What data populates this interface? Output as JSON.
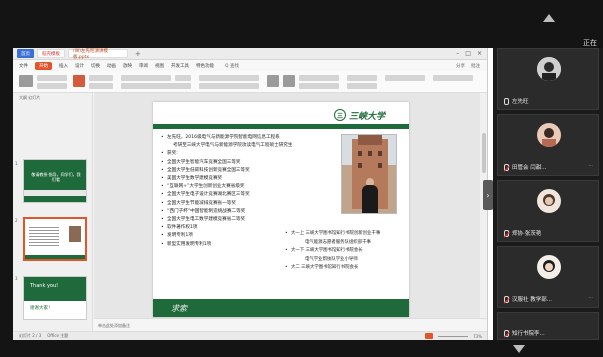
{
  "meeting": {
    "corner_label": "正在",
    "participants": [
      {
        "name": "左先旺",
        "mic": "on"
      },
      {
        "name": "田管会 闫甜...",
        "mic": "off"
      },
      {
        "name": "郑协·张茨艳",
        "mic": "off"
      },
      {
        "name": "汉服社 教学部...",
        "mic": "off"
      },
      {
        "name": "知行书院李...",
        "mic": "off"
      }
    ]
  },
  "wps": {
    "tabs": {
      "home": "首页",
      "shell": "稻壳模板",
      "doc": "(ⅡⅡ)左先旺演讲模板.pptx",
      "add": "+"
    },
    "menu": {
      "file": "文件",
      "start": "开始",
      "insert": "插入",
      "design": "设计",
      "transition": "切换",
      "animation": "动画",
      "slideshow": "放映",
      "review": "审阅",
      "view": "视图",
      "tools": "开发工具",
      "member": "特色功能",
      "search": "Q 查找",
      "share": "分享",
      "comment": "批注"
    },
    "panel": {
      "header": "大纲  幻灯片",
      "thumb1_title": "敬请教授·指导，同学们，我们看",
      "thumb3_title": "Thank you!",
      "thumb3_sub": "谢谢大家！",
      "nums": [
        "1",
        "2",
        "3"
      ]
    },
    "notes_placeholder": "单击此处添加备注",
    "status": {
      "left": "幻灯片 2 / 3",
      "theme": "Office 主题",
      "zoom": "73%"
    }
  },
  "slide": {
    "logo_seal": "三",
    "logo_text": "三峡大学",
    "bullets": [
      {
        "text": "左先旺，2016级电气与新能源学院智能电网信息工程系",
        "sub": false
      },
      {
        "text": "考研至三峡大学电气与新能源学院攻读电气工程硕士研究生",
        "sub": true
      },
      {
        "text": "获奖:",
        "sub": false
      },
      {
        "text": "全国大学生智能汽车竞赛全国三等奖",
        "sub": false
      },
      {
        "text": "全国大学生低碳科技创新竞赛全国三等奖",
        "sub": false
      },
      {
        "text": "美国大学生数学建模竞赛奖",
        "sub": false
      },
      {
        "text": "“互联网+”大学生创新创业大赛省级奖",
        "sub": false
      },
      {
        "text": "全国大学生电子设计竞赛湖北赛区三等奖",
        "sub": false
      },
      {
        "text": "全国大学生节能减排竞赛省一等奖",
        "sub": false
      },
      {
        "text": "“西门子杯”中国智能制造挑战赛二等奖",
        "sub": false
      },
      {
        "text": "全国大学生电工数学建模竞赛省二等奖",
        "sub": false
      },
      {
        "text": "软件著作权1项",
        "sub": false
      },
      {
        "text": "发明专利1项",
        "sub": false
      },
      {
        "text": "新型实用发明专利1项",
        "sub": false
      }
    ],
    "right_list": [
      {
        "text": "大一上  三峡大学图书馆知行书院创新创业干事",
        "sub": false
      },
      {
        "text": "电气能源志愿者服务队组织部干事",
        "sub": true
      },
      {
        "text": "大一下  三峡大学图书馆知行书院会长",
        "sub": false
      },
      {
        "text": "电气学业帮扶队学业小导师",
        "sub": true
      },
      {
        "text": "大二  三峡大学图书馆知行书院会长",
        "sub": false
      }
    ],
    "footer": "求索"
  }
}
